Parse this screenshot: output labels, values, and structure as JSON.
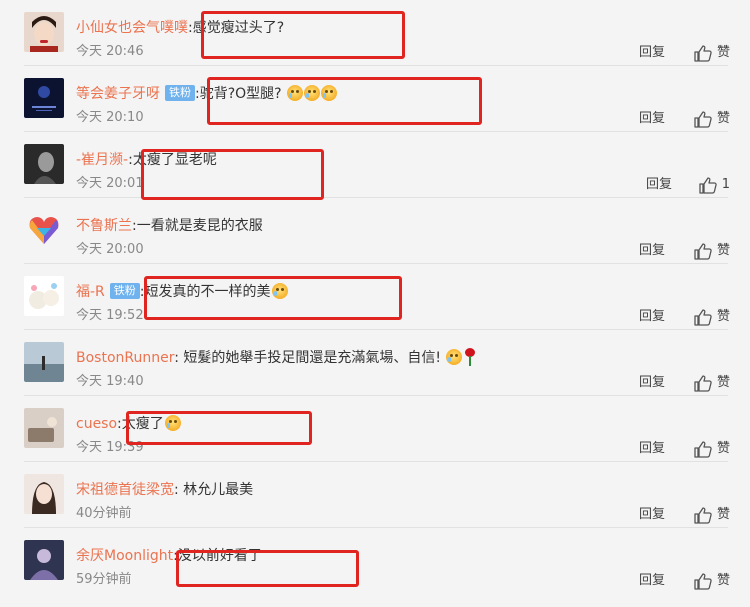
{
  "actions": {
    "reply_label": "回复",
    "like_label": "赞"
  },
  "comments": [
    {
      "username": "小仙女也会气噗噗",
      "badge": "",
      "text": "感觉瘦过头了?",
      "time": "今天 20:46",
      "likes": "赞",
      "emoji": []
    },
    {
      "username": "等会姜子牙呀",
      "badge": "铁粉",
      "text": "驼背?O型腿?",
      "time": "今天 20:10",
      "likes": "赞",
      "emoji": [
        "laugh-cry-emoji",
        "laugh-cry-emoji",
        "laugh-cry-emoji"
      ]
    },
    {
      "username": "-崔月濒-",
      "badge": "",
      "text": "太瘦了显老呢",
      "time": "今天 20:01",
      "likes": "1",
      "emoji": []
    },
    {
      "username": "不鲁斯兰",
      "badge": "",
      "text": "一看就是麦昆的衣服",
      "time": "今天 20:00",
      "likes": "赞",
      "emoji": []
    },
    {
      "username": "福-R",
      "badge": "铁粉",
      "text": "短发真的不一样的美",
      "time": "今天 19:52",
      "likes": "赞",
      "emoji": [
        "crying-emoji"
      ]
    },
    {
      "username": "BostonRunner",
      "badge": "",
      "text": "短髮的她舉手投足間還是充滿氣場、自信!",
      "time": "今天 19:40",
      "likes": "赞",
      "emoji": [
        "teary-emoji",
        "rose-emoji"
      ]
    },
    {
      "username": "cueso",
      "badge": "",
      "text": "太瘦了",
      "time": "今天 19:39",
      "likes": "赞",
      "emoji": [
        "crying-emoji"
      ]
    },
    {
      "username": "宋祖德首徒梁宽",
      "badge": "",
      "text": "林允儿最美",
      "time": "40分钟前",
      "likes": "赞",
      "emoji": []
    },
    {
      "username": "余厌Moonlight",
      "badge": "",
      "text": "没以前好看了",
      "time": "59分钟前",
      "likes": "赞",
      "emoji": []
    }
  ],
  "colors": {
    "username": "#eb7350",
    "badge_bg": "#6fb2ee",
    "highlight_box": "#e0241f",
    "time": "#888888",
    "background": "#f4f4f4"
  }
}
